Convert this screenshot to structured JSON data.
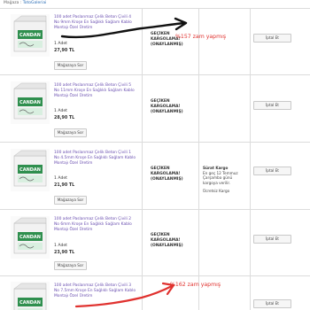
{
  "header": {
    "store_prefix": "Mağaza :",
    "store_name": "TotoGaleriai"
  },
  "orders": [
    {
      "title": "100 adet Paslanmaz Çelik Beton Çivili 4 No 9mm Kroşe En Sağlıklı Sağlam Kablo Montajı Özel Üretim",
      "qty": "1 Adet",
      "price": "27,90 TL",
      "contact": "Mağazaya Sor",
      "status": "GEÇİKEN KARGOLAMA! (ONAYLANMIŞ)",
      "cancel": "İptal Et"
    },
    {
      "title": "100 adet Paslanmaz Çelik Beton Çivili 5 No 11mm Kroşe En Sağlıklı Sağlam Kablo Montajı Özel Üretim",
      "qty": "1 Adet",
      "price": "28,90 TL",
      "contact": "Mağazaya Sor",
      "status": "GEÇİKEN KARGOLAMA! (ONAYLANMIŞ)",
      "cancel": "İptal Et"
    },
    {
      "title": "100 adet Paslanmaz Çelik Beton Çivili 1 No 4.5mm Kroşe En Sağlıklı Sağlam Kablo Montajı Özel Üretim",
      "qty": "1 Adet",
      "price": "21,90 TL",
      "contact": "Mağazaya Sor",
      "status": "GEÇİKEN KARGOLAMA! (ONAYLANMIŞ)",
      "cancel": "İptal Et"
    },
    {
      "title": "100 adet Paslanmaz Çelik Beton Çivili 2 No 6mm Kroşe En Sağlıklı Sağlam Kablo Montajı Özel Üretim",
      "qty": "1 Adet",
      "price": "23,90 TL",
      "contact": "Mağazaya Sor",
      "status": "GEÇİKEN KARGOLAMA! (ONAYLANMIŞ)",
      "cancel": "İptal Et"
    },
    {
      "title": "100 adet Paslanmaz Çelik Beton Çivili 3 No 7.5mm Kroşe En Sağlıklı Sağlam Kablo Montajı Özel Üretim",
      "qty": "",
      "price": "",
      "contact": "",
      "status": "",
      "cancel": "İptal Et"
    }
  ],
  "shipping": {
    "title": "Sürat Kargo",
    "note": "En geç 12 Temmuz Çarşamba günü kargoya verilir.",
    "fee": "Ücretsiz Kargo"
  },
  "annotations": {
    "first": "%157 zam yapmış",
    "second": "%162 zam yapmış"
  },
  "product_brand": "CANDAN",
  "colors": {
    "link": "#6a4fb0",
    "annotation": "#e0322f",
    "box_green": "#2f8f4e"
  }
}
